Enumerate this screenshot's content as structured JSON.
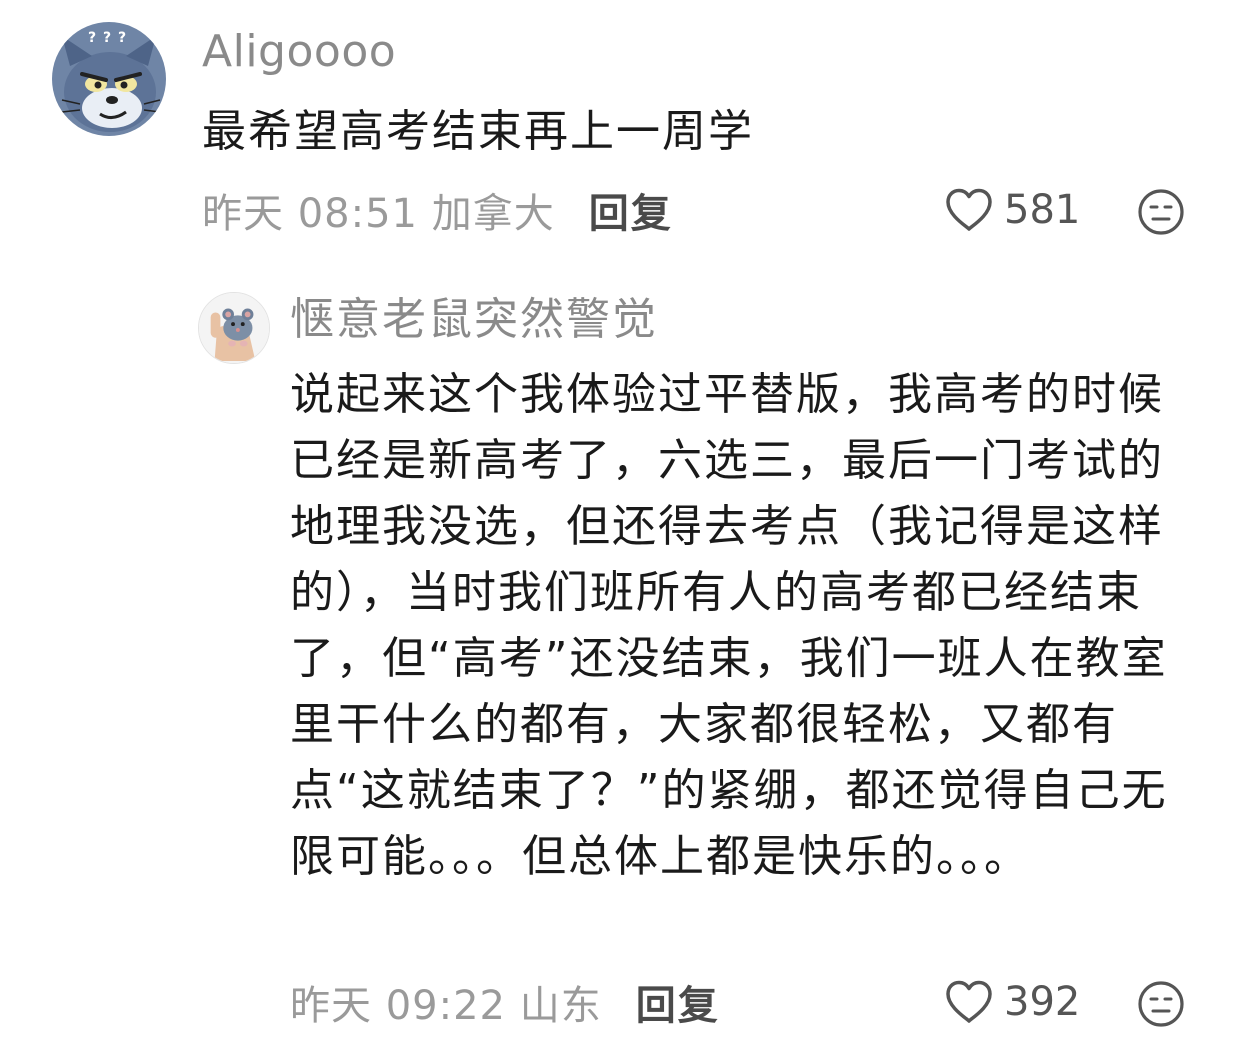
{
  "comments": [
    {
      "username": "Aligoooo",
      "text": "最希望高考结束再上一周学",
      "meta": "昨天 08:51 加拿大",
      "reply_label": "回复",
      "likes": "581",
      "avatar_icon": "cartoon-cat-avatar",
      "avatar_badge": "? ? ?"
    },
    {
      "username": "惬意老鼠突然警觉",
      "text": "说起来这个我体验过平替版，我高考的时候已经是新高考了，六选三，最后一门考试的地理我没选，但还得去考点（我记得是这样的），当时我们班所有人的高考都已经结束了，但“高考”还没结束，我们一班人在教室里干什么的都有，大家都很轻松，又都有点“这就结束了？”的紧绷，都还觉得自己无限可能。。。但总体上都是快乐的。。。",
      "meta": "昨天 09:22 山东",
      "reply_label": "回复",
      "likes": "392",
      "avatar_icon": "mouse-in-hand-avatar"
    }
  ],
  "icons": {
    "like": "heart-icon",
    "emoji": "neutral-face-icon"
  },
  "colors": {
    "username": "#8a8a8a",
    "meta": "#9a9a9a",
    "text": "#1a1a1a",
    "icon_stroke": "#555555"
  }
}
